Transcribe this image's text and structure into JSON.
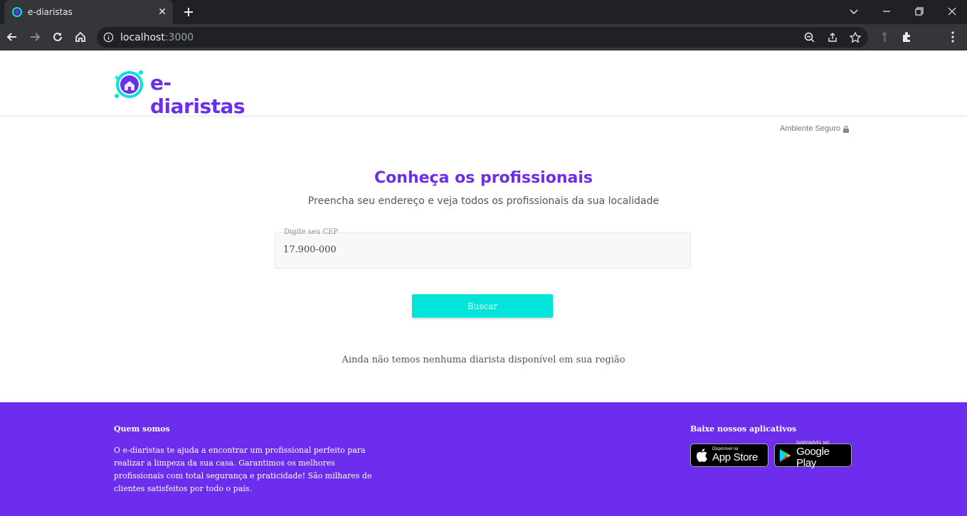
{
  "browser": {
    "tab_title": "e-diaristas",
    "url_host": "localhost",
    "url_port": ":3000"
  },
  "header": {
    "logo_text": "e-diaristas"
  },
  "secure_label": "Ambiente Seguro",
  "main": {
    "title": "Conheça os profissionais",
    "subtitle": "Preencha seu endereço e veja todos os profissionais da sua localidade",
    "cep_label": "Digite seu CEP",
    "cep_value": "17.900-000",
    "search_button": "Buscar",
    "empty_message": "Ainda não temos nenhuma diarista disponível em sua região"
  },
  "footer": {
    "about_title": "Quem somos",
    "about_text": "O e-diaristas te ajuda a encontrar um profissional perfeito para realizar a limpeza da sua casa. Garantimos os melhores profissionais com total segurança e praticidade! São milhares de clientes satisfeitos por todo o país.",
    "apps_title": "Baixe nossos aplicativos",
    "app_store_small": "Disponível na",
    "app_store_big": "App Store",
    "google_play_small": "DISPONÍVEL NO",
    "google_play_big": "Google Play"
  },
  "colors": {
    "brand_purple": "#6c2eec",
    "accent_cyan": "#00e4d9"
  }
}
